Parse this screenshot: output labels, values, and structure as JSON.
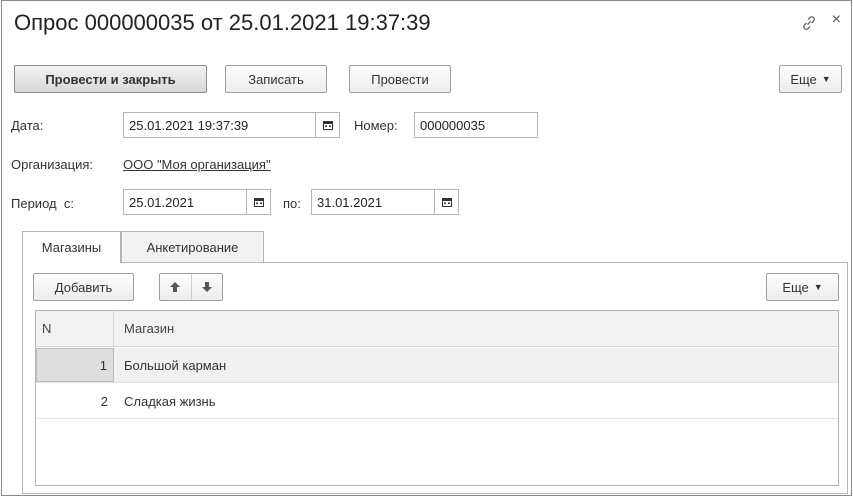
{
  "window": {
    "title": "Опрос 000000035 от 25.01.2021 19:37:39",
    "close_glyph": "×"
  },
  "toolbar": {
    "post_and_close": "Провести и закрыть",
    "save": "Записать",
    "post": "Провести",
    "more": "Еще"
  },
  "form": {
    "date_label": "Дата:",
    "date_value": "25.01.2021 19:37:39",
    "number_label": "Номер:",
    "number_value": "000000035",
    "organization_label": "Организация:",
    "organization_value": "ООО \"Моя организация\"",
    "period_label": "Период  с:",
    "period_from": "25.01.2021",
    "period_to_label": "по:",
    "period_to": "31.01.2021"
  },
  "tabs": [
    {
      "label": "Магазины",
      "active": true
    },
    {
      "label": "Анкетирование",
      "active": false
    }
  ],
  "table_toolbar": {
    "add": "Добавить",
    "more": "Еще"
  },
  "table": {
    "columns": [
      "N",
      "Магазин"
    ],
    "rows": [
      {
        "n": "1",
        "name": "Большой карман",
        "selected": true
      },
      {
        "n": "2",
        "name": "Сладкая жизнь",
        "selected": false
      }
    ]
  }
}
